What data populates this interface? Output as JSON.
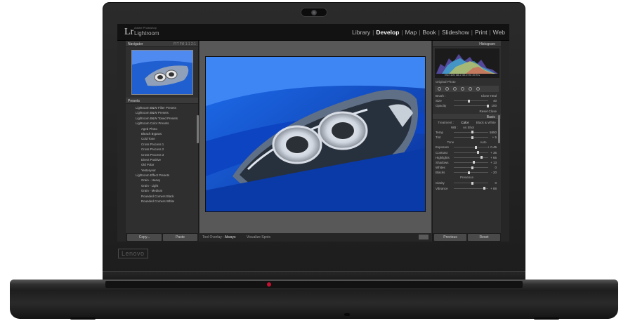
{
  "brand": "Lenovo",
  "lightroom": {
    "logo": "Lr",
    "sub_title": "Adobe Photoshop",
    "app_name": "Lightroom",
    "modules": [
      "Library",
      "Develop",
      "Map",
      "Book",
      "Slideshow",
      "Print",
      "Web"
    ],
    "active_module": "Develop"
  },
  "left_panel": {
    "navigator_title": "Navigator",
    "navigator_zoom": "FIT  Fill  1:1  2:1",
    "presets_title": "Presets",
    "presets": [
      {
        "type": "folder",
        "label": "Lightroom B&W Filter Presets"
      },
      {
        "type": "folder",
        "label": "Lightroom B&W Presets"
      },
      {
        "type": "folder",
        "label": "Lightroom B&W Toned Presets"
      },
      {
        "type": "folder",
        "label": "Lightroom Color Presets"
      },
      {
        "type": "item",
        "label": "Aged Photo"
      },
      {
        "type": "item",
        "label": "Bleach Bypass"
      },
      {
        "type": "item",
        "label": "Cold Tone"
      },
      {
        "type": "item",
        "label": "Cross Process 1"
      },
      {
        "type": "item",
        "label": "Cross Process 2"
      },
      {
        "type": "item",
        "label": "Cross Process 3"
      },
      {
        "type": "item",
        "label": "Direct Positive"
      },
      {
        "type": "item",
        "label": "Old Polar"
      },
      {
        "type": "item",
        "label": "Yesteryear"
      },
      {
        "type": "folder",
        "label": "Lightroom Effect Presets"
      },
      {
        "type": "item",
        "label": "Grain - Heavy"
      },
      {
        "type": "item",
        "label": "Grain - Light"
      },
      {
        "type": "item",
        "label": "Grain - Medium"
      },
      {
        "type": "item",
        "label": "Rounded Corners Black"
      },
      {
        "type": "item",
        "label": "Rounded Corners White"
      }
    ],
    "copy_button": "Copy...",
    "paste_button": "Paste"
  },
  "toolbar": {
    "overlay_label": "Tool Overlay :",
    "overlay_value": "Always",
    "spot_label": "Visualize Spots"
  },
  "right_panel": {
    "histogram_title": "Histogram",
    "histogram_readout": "ISO 100   38.2   40.0   f/4   19.9 s",
    "original_photo": "Original Photo",
    "brush_label": "Brush :",
    "brush_options": "Clone   Heal",
    "size_label": "Size",
    "size_value": "40",
    "opacity_label": "Opacity",
    "opacity_value": "100",
    "reset_label": "Reset   Close",
    "basic_title": "Basic",
    "treatment_label": "Treatment :",
    "treatment_color": "Color",
    "treatment_bw": "Black & White",
    "wb_label": "WB :",
    "wb_value": "As Shot",
    "temp_label": "Temp",
    "temp_value": "5850",
    "tint_label": "Tint",
    "tint_value": "+ 5",
    "tone_label": "Tone",
    "tone_auto": "Auto",
    "sliders": [
      {
        "label": "Exposure",
        "value": "+ 0.45",
        "pos": 0.62
      },
      {
        "label": "Contrast",
        "value": "+ 36",
        "pos": 0.68
      },
      {
        "label": "Highlights",
        "value": "+ 65",
        "pos": 0.78
      },
      {
        "label": "Shadows",
        "value": "+ 13",
        "pos": 0.56
      },
      {
        "label": "Whites",
        "value": "0",
        "pos": 0.5
      },
      {
        "label": "Blacks",
        "value": "- 20",
        "pos": 0.4
      }
    ],
    "presence_label": "Presence",
    "presence_sliders": [
      {
        "label": "Clarity",
        "value": "0",
        "pos": 0.5
      },
      {
        "label": "Vibrance",
        "value": "+ 88",
        "pos": 0.86
      }
    ],
    "previous_button": "Previous",
    "reset_button": "Reset"
  },
  "colors": {
    "accent_blue": "#1f5fd0",
    "panel_bg": "#2f2f2f",
    "top_bar": "#121212"
  }
}
